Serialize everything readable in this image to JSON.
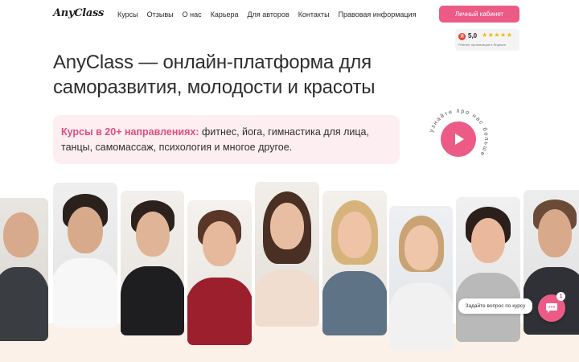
{
  "header": {
    "logo_text": "AnyClass",
    "nav": [
      "Курсы",
      "Отзывы",
      "О нас",
      "Карьера",
      "Для авторов",
      "Контакты",
      "Правовая информация"
    ],
    "cabinet_button": "Личный кабинет"
  },
  "rating": {
    "score": "5,0",
    "stars": "★★★★★",
    "caption": "Рейтинг организации в Яндексе",
    "icon": "yandex-icon"
  },
  "hero": {
    "title": "AnyClass — онлайн-платформа для саморазвития, молодости и красоты",
    "directions_accent": "Курсы в 20+ направлениях:",
    "directions_text": " фитнес, йога, гимнастика для лица, танцы, самомассаж, психология и многое другое.",
    "play_ring_text": "узнайте про нас больше",
    "play_icon": "play-icon"
  },
  "chat": {
    "prompt": "Задайте вопрос по курсу",
    "badge_count": "1",
    "icon": "chat-icon"
  },
  "colors": {
    "accent": "#ec5b86",
    "accent_text": "#e04d7e",
    "directions_bg": "#fdeff1",
    "band_bg": "#fbf1e9"
  }
}
